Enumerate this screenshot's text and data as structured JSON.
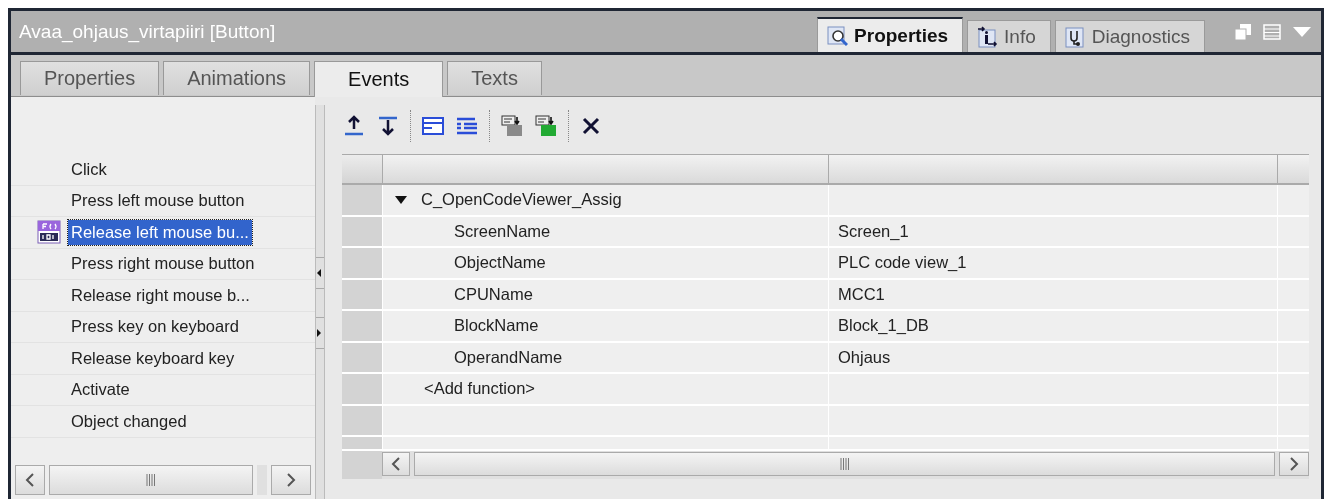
{
  "panel_title": "Avaa_ohjaus_virtapiiri [Button]",
  "inspector_tabs": [
    {
      "label": "Properties",
      "kind": "properties",
      "selected": true
    },
    {
      "label": "Info",
      "kind": "info",
      "selected": false
    },
    {
      "label": "Diagnostics",
      "kind": "diagnostics",
      "selected": false
    }
  ],
  "tabs": [
    {
      "label": "Properties",
      "selected": false
    },
    {
      "label": "Animations",
      "selected": false
    },
    {
      "label": "Events",
      "selected": true
    },
    {
      "label": "Texts",
      "selected": false
    }
  ],
  "events": [
    {
      "label": "Click",
      "selected": false,
      "has_function": false
    },
    {
      "label": "Press left mouse button",
      "selected": false,
      "has_function": false
    },
    {
      "label": "Release left mouse bu...",
      "selected": true,
      "has_function": true
    },
    {
      "label": "Press right mouse button",
      "selected": false,
      "has_function": false
    },
    {
      "label": "Release right mouse b...",
      "selected": false,
      "has_function": false
    },
    {
      "label": "Press key on keyboard",
      "selected": false,
      "has_function": false
    },
    {
      "label": "Release keyboard key",
      "selected": false,
      "has_function": false
    },
    {
      "label": "Activate",
      "selected": false,
      "has_function": false
    },
    {
      "label": "Object changed",
      "selected": false,
      "has_function": false
    }
  ],
  "function_list": {
    "rows": [
      {
        "kind": "function",
        "name": "C_OpenCodeViewer_Assig",
        "expanded": true,
        "children": [
          {
            "name": "ScreenName",
            "value": "Screen_1"
          },
          {
            "name": "ObjectName",
            "value": "PLC code view_1"
          },
          {
            "name": "CPUName",
            "value": "MCC1"
          },
          {
            "name": "BlockName",
            "value": "Block_1_DB"
          },
          {
            "name": "OperandName",
            "value": "Ohjaus"
          }
        ]
      },
      {
        "kind": "add",
        "name": "<Add function>"
      }
    ]
  }
}
